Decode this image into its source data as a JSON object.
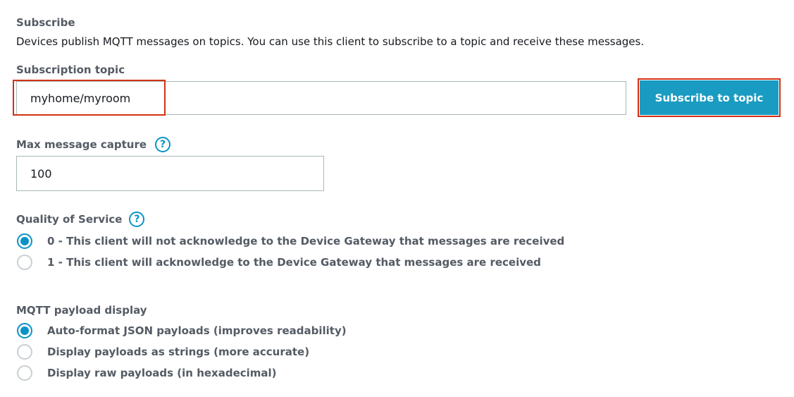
{
  "section": {
    "title": "Subscribe",
    "description": "Devices publish MQTT messages on topics. You can use this client to subscribe to a topic and receive these messages."
  },
  "subscription": {
    "label": "Subscription topic",
    "value": "myhome/myroom",
    "button_label": "Subscribe to topic"
  },
  "max_capture": {
    "label": "Max message capture",
    "value": "100",
    "help_icon": "?"
  },
  "qos": {
    "label": "Quality of Service",
    "help_icon": "?",
    "options": [
      {
        "label": "0 - This client will not acknowledge to the Device Gateway that messages are received",
        "checked": true
      },
      {
        "label": "1 - This client will acknowledge to the Device Gateway that messages are received",
        "checked": false
      }
    ]
  },
  "payload_display": {
    "label": "MQTT payload display",
    "options": [
      {
        "label": "Auto-format JSON payloads (improves readability)",
        "checked": true
      },
      {
        "label": "Display payloads as strings (more accurate)",
        "checked": false
      },
      {
        "label": "Display raw payloads (in hexadecimal)",
        "checked": false
      }
    ]
  },
  "colors": {
    "accent": "#0a93c7",
    "button": "#1a9bc2",
    "highlight": "#d13212",
    "label": "#545b64"
  }
}
